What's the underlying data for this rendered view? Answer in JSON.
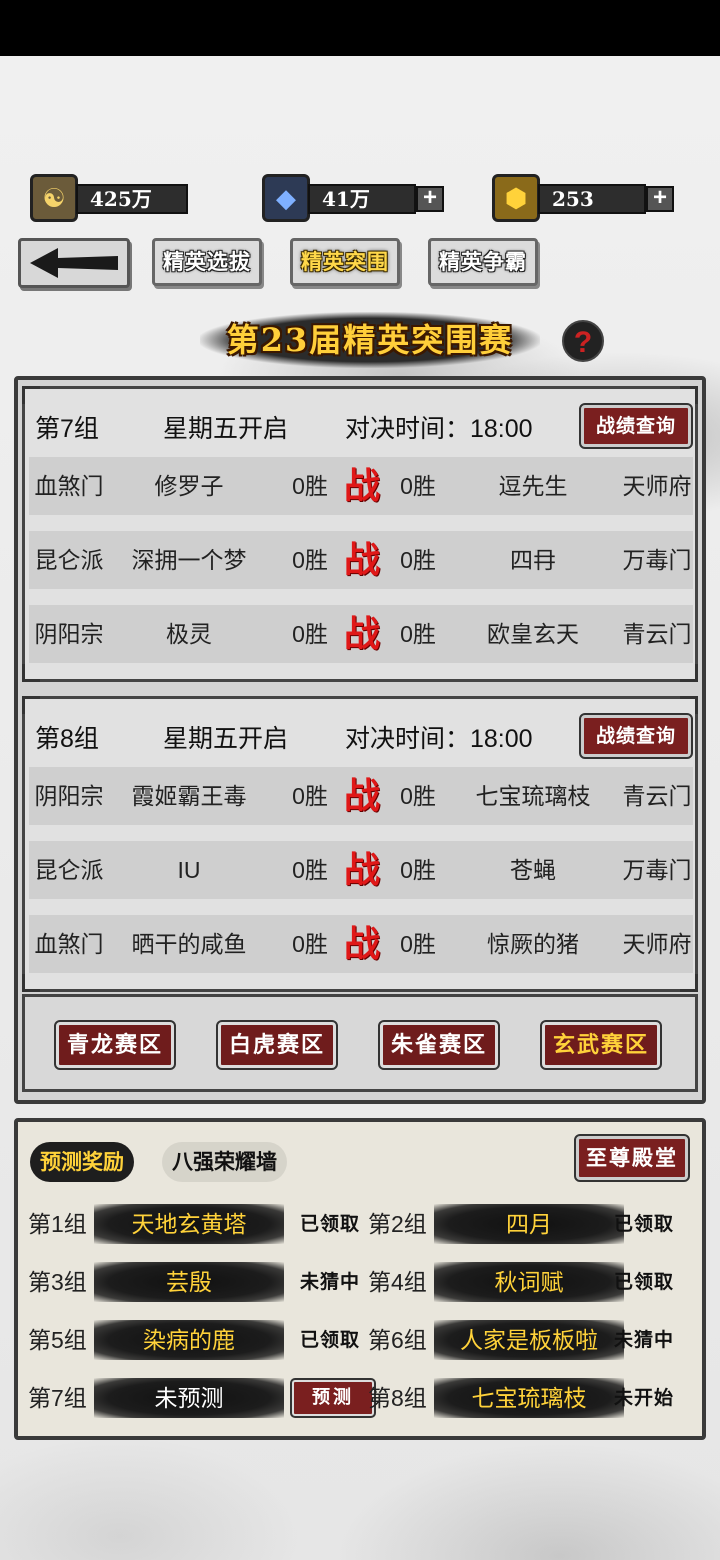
{
  "currency": [
    {
      "icon": "taiji-coin-icon",
      "value": "425万",
      "has_plus": false
    },
    {
      "icon": "blue-crystal-icon",
      "value": "41万",
      "has_plus": true
    },
    {
      "icon": "gold-ingot-icon",
      "value": "253",
      "has_plus": true
    }
  ],
  "plus_symbol": "+",
  "nav": {
    "back_icon": "back-arrow-icon",
    "tabs": [
      {
        "label": "精英选拔",
        "active": false
      },
      {
        "label": "精英突围",
        "active": true
      },
      {
        "label": "精英争霸",
        "active": false
      }
    ]
  },
  "title": "第23届精英突围赛",
  "help_symbol": "?",
  "vs_label": "战",
  "groups": [
    {
      "name": "第7组",
      "open_day": "星期五开启",
      "time_label": "对决时间：18:00",
      "record_button": "战绩查询",
      "matches": [
        {
          "sect_a": "血煞门",
          "player_a": "修罗子",
          "wins_a": "0胜",
          "wins_b": "0胜",
          "player_b": "逗先生",
          "sect_b": "天师府"
        },
        {
          "sect_a": "昆仑派",
          "player_a": "深拥一个梦",
          "wins_a": "0胜",
          "wins_b": "0胜",
          "player_b": "四冄",
          "sect_b": "万毒门"
        },
        {
          "sect_a": "阴阳宗",
          "player_a": "极灵",
          "wins_a": "0胜",
          "wins_b": "0胜",
          "player_b": "欧皇玄天",
          "sect_b": "青云门"
        }
      ]
    },
    {
      "name": "第8组",
      "open_day": "星期五开启",
      "time_label": "对决时间：18:00",
      "record_button": "战绩查询",
      "matches": [
        {
          "sect_a": "阴阳宗",
          "player_a": "霞姬霸王毒",
          "wins_a": "0胜",
          "wins_b": "0胜",
          "player_b": "七宝琉璃枝",
          "sect_b": "青云门"
        },
        {
          "sect_a": "昆仑派",
          "player_a": "IU",
          "wins_a": "0胜",
          "wins_b": "0胜",
          "player_b": "苍蝇",
          "sect_b": "万毒门"
        },
        {
          "sect_a": "血煞门",
          "player_a": "晒干的咸鱼",
          "wins_a": "0胜",
          "wins_b": "0胜",
          "player_b": "惊厥的猪",
          "sect_b": "天师府"
        }
      ]
    }
  ],
  "zones": [
    {
      "label": "青龙赛区",
      "active": false
    },
    {
      "label": "白虎赛区",
      "active": false
    },
    {
      "label": "朱雀赛区",
      "active": false
    },
    {
      "label": "玄武赛区",
      "active": true
    }
  ],
  "prediction": {
    "tabs": [
      {
        "label": "预测奖励",
        "active": true
      },
      {
        "label": "八强荣耀墙",
        "active": false
      }
    ],
    "hall_button": "至尊殿堂",
    "predict_button": "预测",
    "items": [
      {
        "group": "第1组",
        "pick": "天地玄黄塔",
        "status": "已领取"
      },
      {
        "group": "第2组",
        "pick": "四月",
        "status": "已领取"
      },
      {
        "group": "第3组",
        "pick": "芸殷",
        "status": "未猜中"
      },
      {
        "group": "第4组",
        "pick": "秋词赋",
        "status": "已领取"
      },
      {
        "group": "第5组",
        "pick": "染病的鹿",
        "status": "已领取"
      },
      {
        "group": "第6组",
        "pick": "人家是板板啦",
        "status": "未猜中"
      },
      {
        "group": "第7组",
        "pick": "未预测",
        "status": ""
      },
      {
        "group": "第8组",
        "pick": "七宝琉璃枝",
        "status": "未开始"
      }
    ]
  }
}
